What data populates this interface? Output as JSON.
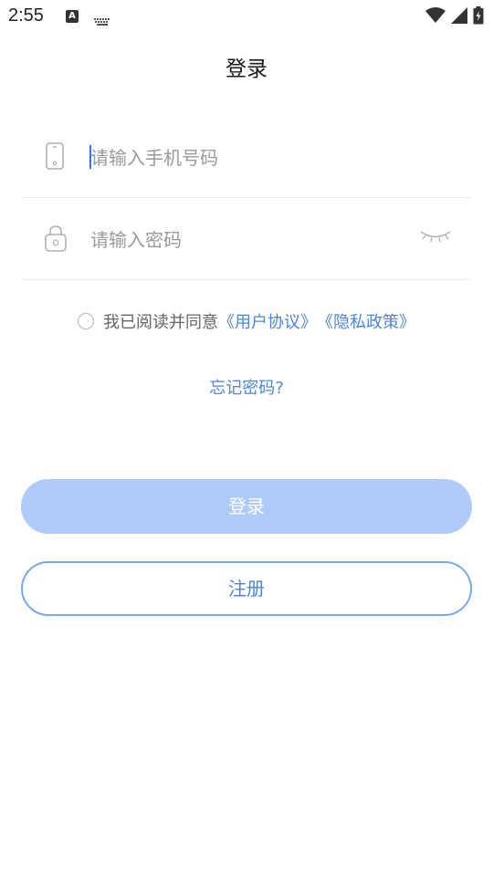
{
  "status_bar": {
    "time": "2:55",
    "notification_icon_letter": "A",
    "icons": [
      "a-notification-icon",
      "keyboard-icon",
      "wifi-icon",
      "signal-icon",
      "battery-charging-icon"
    ]
  },
  "page": {
    "title": "登录"
  },
  "phone_field": {
    "placeholder": "请输入手机号码",
    "value": "",
    "icon": "phone-icon"
  },
  "password_field": {
    "placeholder": "请输入密码",
    "value": "",
    "icon": "lock-icon",
    "toggle_icon": "eye-closed-icon"
  },
  "agreement": {
    "checked": false,
    "text": "我已阅读并同意",
    "user_agreement_link": "《用户协议》",
    "privacy_policy_link": "《隐私政策》"
  },
  "forgot_password": "忘记密码?",
  "buttons": {
    "login_label": "登录",
    "register_label": "注册"
  },
  "colors": {
    "accent": "#4a86df",
    "login_button_disabled": "#aecbfa",
    "register_border": "#7aa8ec",
    "placeholder": "#9a9a9a"
  }
}
